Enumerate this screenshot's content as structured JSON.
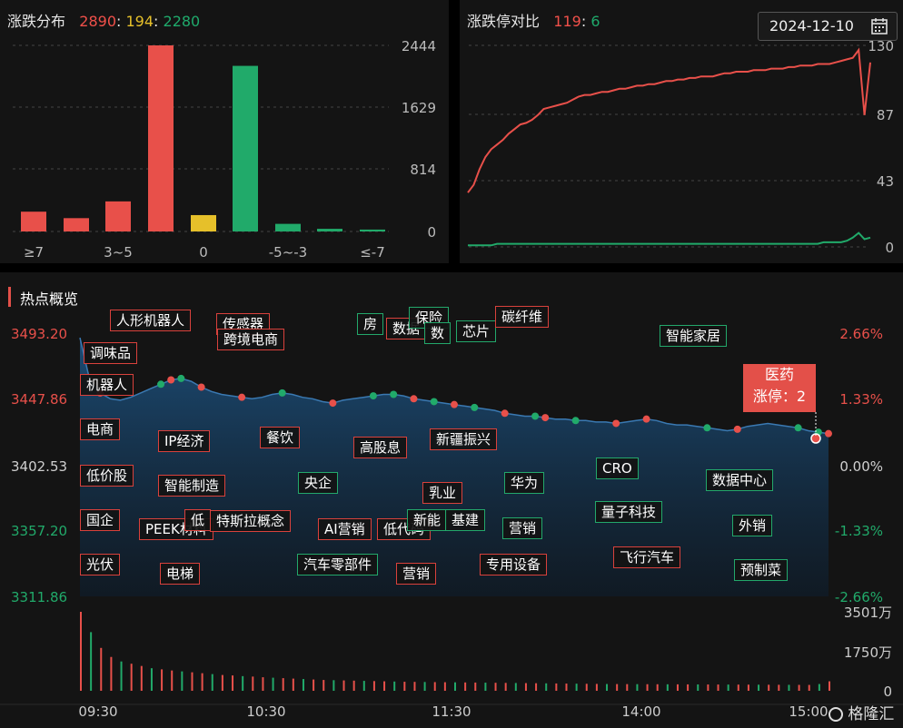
{
  "dist": {
    "title": "涨跌分布",
    "up": "2890",
    "flat": "194",
    "down": "2280",
    "yticks": [
      "2444",
      "1629",
      "814",
      "0"
    ],
    "categories": [
      "≥7",
      "3~5",
      "0",
      "-5~-3",
      "≤-7"
    ],
    "bar_values": [
      260,
      175,
      395,
      2444,
      215,
      2175,
      100,
      35,
      25
    ],
    "bar_colors": [
      "#e8504a",
      "#e8504a",
      "#e8504a",
      "#e8504a",
      "#e6c02a",
      "#21aa6a",
      "#21aa6a",
      "#21aa6a",
      "#21aa6a"
    ]
  },
  "limit": {
    "title": "涨跌停对比",
    "up": "119",
    "down": "6",
    "yticks": [
      "130",
      "87",
      "43",
      "0"
    ],
    "up_series": [
      35,
      40,
      50,
      58,
      63,
      66,
      69,
      73,
      76,
      79,
      80,
      82,
      85,
      89,
      90,
      91,
      92,
      93,
      95,
      97,
      98,
      98,
      99,
      100,
      100,
      101,
      102,
      102,
      103,
      104,
      104,
      105,
      105,
      106,
      107,
      107,
      108,
      108,
      109,
      109,
      110,
      110,
      110,
      111,
      112,
      112,
      113,
      113,
      113,
      114,
      114,
      114,
      115,
      115,
      115,
      116,
      116,
      117,
      117,
      117,
      118,
      118,
      118,
      119,
      120,
      121,
      122,
      127,
      85,
      119
    ],
    "down_series": [
      1,
      1,
      1,
      1,
      1,
      2,
      2,
      2,
      2,
      2,
      2,
      2,
      2,
      2,
      2,
      2,
      2,
      2,
      2,
      2,
      2,
      2,
      2,
      2,
      2,
      2,
      2,
      2,
      2,
      2,
      2,
      2,
      2,
      2,
      2,
      2,
      2,
      2,
      2,
      2,
      2,
      2,
      2,
      2,
      2,
      2,
      2,
      2,
      2,
      2,
      2,
      2,
      2,
      2,
      2,
      2,
      2,
      2,
      2,
      2,
      2,
      3,
      3,
      3,
      3,
      4,
      6,
      9,
      5,
      6
    ]
  },
  "hot": {
    "title": "热点概览",
    "date": "2024-12-10",
    "left_ticks": [
      "3493.20",
      "3447.86",
      "3402.53",
      "3357.20",
      "3311.86"
    ],
    "right_ticks": [
      "2.66%",
      "1.33%",
      "0.00%",
      "-1.33%",
      "-2.66%"
    ],
    "vol_ticks": [
      "3501万",
      "1750万",
      "0"
    ],
    "time_ticks": [
      "09:30",
      "10:30",
      "11:30",
      "14:00",
      "15:00"
    ],
    "index_series": [
      3490,
      3460,
      3452,
      3448,
      3447,
      3449,
      3452,
      3455,
      3458,
      3461,
      3462,
      3460,
      3456,
      3453,
      3451,
      3450,
      3449,
      3448,
      3449,
      3451,
      3452,
      3451,
      3449,
      3448,
      3446,
      3445,
      3447,
      3448,
      3449,
      3450,
      3451,
      3451,
      3450,
      3448,
      3447,
      3446,
      3445,
      3444,
      3443,
      3442,
      3441,
      3440,
      3438,
      3437,
      3436,
      3436,
      3435,
      3434,
      3434,
      3433,
      3433,
      3432,
      3432,
      3431,
      3432,
      3433,
      3434,
      3433,
      3431,
      3430,
      3430,
      3429,
      3428,
      3427,
      3426,
      3427,
      3429,
      3430,
      3431,
      3430,
      3429,
      3428,
      3426,
      3425,
      3424
    ],
    "volume_series": [
      3501,
      2600,
      1900,
      1500,
      1300,
      1200,
      1100,
      1000,
      950,
      900,
      860,
      820,
      780,
      740,
      700,
      680,
      650,
      630,
      600,
      580,
      560,
      540,
      520,
      500,
      480,
      470,
      460,
      450,
      440,
      430,
      420,
      410,
      400,
      395,
      390,
      385,
      380,
      375,
      370,
      365,
      360,
      355,
      350,
      345,
      340,
      335,
      330,
      325,
      320,
      315,
      310,
      305,
      300,
      298,
      296,
      294,
      292,
      290,
      288,
      286,
      284,
      282,
      280,
      278,
      276,
      274,
      272,
      270,
      268,
      266,
      264,
      262,
      260,
      300,
      420
    ],
    "tag": {
      "name": "医药",
      "line": "涨停：2"
    },
    "labels": [
      {
        "text": "人形机器人",
        "c": "r"
      },
      {
        "text": "传感器",
        "c": "r"
      },
      {
        "text": "调味品",
        "c": "r"
      },
      {
        "text": "跨境电商",
        "c": "r"
      },
      {
        "text": "房",
        "c": "g"
      },
      {
        "text": "数据",
        "c": "r"
      },
      {
        "text": "保险",
        "c": "g"
      },
      {
        "text": "数",
        "c": "g"
      },
      {
        "text": "芯片",
        "c": "g"
      },
      {
        "text": "碳纤维",
        "c": "r"
      },
      {
        "text": "智能家居",
        "c": "g"
      },
      {
        "text": "机器人",
        "c": "r"
      },
      {
        "text": "电商",
        "c": "r"
      },
      {
        "text": "IP经济",
        "c": "r"
      },
      {
        "text": "餐饮",
        "c": "r"
      },
      {
        "text": "高股息",
        "c": "r"
      },
      {
        "text": "新疆振兴",
        "c": "r"
      },
      {
        "text": "低价股",
        "c": "r"
      },
      {
        "text": "智能制造",
        "c": "r"
      },
      {
        "text": "央企",
        "c": "g"
      },
      {
        "text": "乳业",
        "c": "r"
      },
      {
        "text": "华为",
        "c": "g"
      },
      {
        "text": "CRO",
        "c": "g"
      },
      {
        "text": "数据中心",
        "c": "g"
      },
      {
        "text": "国企",
        "c": "r"
      },
      {
        "text": "PEEK材料",
        "c": "r"
      },
      {
        "text": "低",
        "c": "r"
      },
      {
        "text": "特斯拉概念",
        "c": "r"
      },
      {
        "text": "AI营销",
        "c": "r"
      },
      {
        "text": "低代码",
        "c": "r"
      },
      {
        "text": "新能",
        "c": "g"
      },
      {
        "text": "基建",
        "c": "g"
      },
      {
        "text": "量子科技",
        "c": "g"
      },
      {
        "text": "营销",
        "c": "g"
      },
      {
        "text": "外销",
        "c": "g"
      },
      {
        "text": "光伏",
        "c": "r"
      },
      {
        "text": "电梯",
        "c": "r"
      },
      {
        "text": "汽车零部件",
        "c": "g"
      },
      {
        "text": "营销",
        "c": "r"
      },
      {
        "text": "专用设备",
        "c": "r"
      },
      {
        "text": "飞行汽车",
        "c": "r"
      },
      {
        "text": "预制菜",
        "c": "g"
      }
    ]
  },
  "watermark": "格隆汇"
}
